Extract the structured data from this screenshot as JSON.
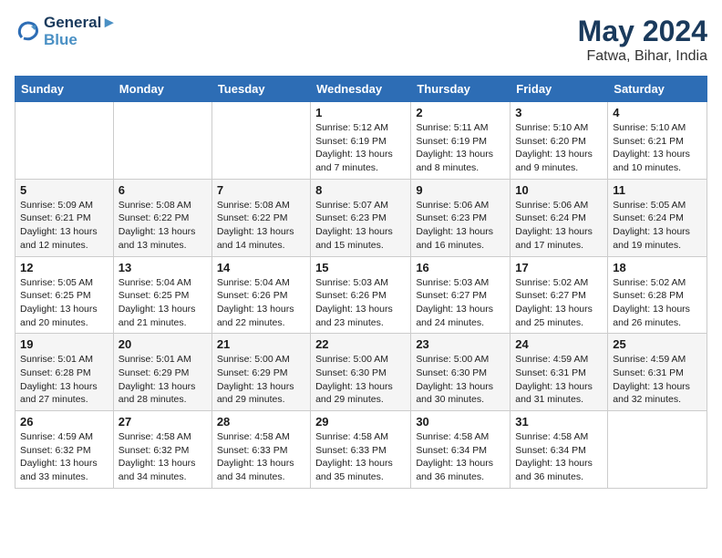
{
  "header": {
    "logo_line1": "General",
    "logo_line2": "Blue",
    "month_year": "May 2024",
    "location": "Fatwa, Bihar, India"
  },
  "weekdays": [
    "Sunday",
    "Monday",
    "Tuesday",
    "Wednesday",
    "Thursday",
    "Friday",
    "Saturday"
  ],
  "weeks": [
    [
      {
        "day": "",
        "info": ""
      },
      {
        "day": "",
        "info": ""
      },
      {
        "day": "",
        "info": ""
      },
      {
        "day": "1",
        "info": "Sunrise: 5:12 AM\nSunset: 6:19 PM\nDaylight: 13 hours\nand 7 minutes."
      },
      {
        "day": "2",
        "info": "Sunrise: 5:11 AM\nSunset: 6:19 PM\nDaylight: 13 hours\nand 8 minutes."
      },
      {
        "day": "3",
        "info": "Sunrise: 5:10 AM\nSunset: 6:20 PM\nDaylight: 13 hours\nand 9 minutes."
      },
      {
        "day": "4",
        "info": "Sunrise: 5:10 AM\nSunset: 6:21 PM\nDaylight: 13 hours\nand 10 minutes."
      }
    ],
    [
      {
        "day": "5",
        "info": "Sunrise: 5:09 AM\nSunset: 6:21 PM\nDaylight: 13 hours\nand 12 minutes."
      },
      {
        "day": "6",
        "info": "Sunrise: 5:08 AM\nSunset: 6:22 PM\nDaylight: 13 hours\nand 13 minutes."
      },
      {
        "day": "7",
        "info": "Sunrise: 5:08 AM\nSunset: 6:22 PM\nDaylight: 13 hours\nand 14 minutes."
      },
      {
        "day": "8",
        "info": "Sunrise: 5:07 AM\nSunset: 6:23 PM\nDaylight: 13 hours\nand 15 minutes."
      },
      {
        "day": "9",
        "info": "Sunrise: 5:06 AM\nSunset: 6:23 PM\nDaylight: 13 hours\nand 16 minutes."
      },
      {
        "day": "10",
        "info": "Sunrise: 5:06 AM\nSunset: 6:24 PM\nDaylight: 13 hours\nand 17 minutes."
      },
      {
        "day": "11",
        "info": "Sunrise: 5:05 AM\nSunset: 6:24 PM\nDaylight: 13 hours\nand 19 minutes."
      }
    ],
    [
      {
        "day": "12",
        "info": "Sunrise: 5:05 AM\nSunset: 6:25 PM\nDaylight: 13 hours\nand 20 minutes."
      },
      {
        "day": "13",
        "info": "Sunrise: 5:04 AM\nSunset: 6:25 PM\nDaylight: 13 hours\nand 21 minutes."
      },
      {
        "day": "14",
        "info": "Sunrise: 5:04 AM\nSunset: 6:26 PM\nDaylight: 13 hours\nand 22 minutes."
      },
      {
        "day": "15",
        "info": "Sunrise: 5:03 AM\nSunset: 6:26 PM\nDaylight: 13 hours\nand 23 minutes."
      },
      {
        "day": "16",
        "info": "Sunrise: 5:03 AM\nSunset: 6:27 PM\nDaylight: 13 hours\nand 24 minutes."
      },
      {
        "day": "17",
        "info": "Sunrise: 5:02 AM\nSunset: 6:27 PM\nDaylight: 13 hours\nand 25 minutes."
      },
      {
        "day": "18",
        "info": "Sunrise: 5:02 AM\nSunset: 6:28 PM\nDaylight: 13 hours\nand 26 minutes."
      }
    ],
    [
      {
        "day": "19",
        "info": "Sunrise: 5:01 AM\nSunset: 6:28 PM\nDaylight: 13 hours\nand 27 minutes."
      },
      {
        "day": "20",
        "info": "Sunrise: 5:01 AM\nSunset: 6:29 PM\nDaylight: 13 hours\nand 28 minutes."
      },
      {
        "day": "21",
        "info": "Sunrise: 5:00 AM\nSunset: 6:29 PM\nDaylight: 13 hours\nand 29 minutes."
      },
      {
        "day": "22",
        "info": "Sunrise: 5:00 AM\nSunset: 6:30 PM\nDaylight: 13 hours\nand 29 minutes."
      },
      {
        "day": "23",
        "info": "Sunrise: 5:00 AM\nSunset: 6:30 PM\nDaylight: 13 hours\nand 30 minutes."
      },
      {
        "day": "24",
        "info": "Sunrise: 4:59 AM\nSunset: 6:31 PM\nDaylight: 13 hours\nand 31 minutes."
      },
      {
        "day": "25",
        "info": "Sunrise: 4:59 AM\nSunset: 6:31 PM\nDaylight: 13 hours\nand 32 minutes."
      }
    ],
    [
      {
        "day": "26",
        "info": "Sunrise: 4:59 AM\nSunset: 6:32 PM\nDaylight: 13 hours\nand 33 minutes."
      },
      {
        "day": "27",
        "info": "Sunrise: 4:58 AM\nSunset: 6:32 PM\nDaylight: 13 hours\nand 34 minutes."
      },
      {
        "day": "28",
        "info": "Sunrise: 4:58 AM\nSunset: 6:33 PM\nDaylight: 13 hours\nand 34 minutes."
      },
      {
        "day": "29",
        "info": "Sunrise: 4:58 AM\nSunset: 6:33 PM\nDaylight: 13 hours\nand 35 minutes."
      },
      {
        "day": "30",
        "info": "Sunrise: 4:58 AM\nSunset: 6:34 PM\nDaylight: 13 hours\nand 36 minutes."
      },
      {
        "day": "31",
        "info": "Sunrise: 4:58 AM\nSunset: 6:34 PM\nDaylight: 13 hours\nand 36 minutes."
      },
      {
        "day": "",
        "info": ""
      }
    ]
  ]
}
